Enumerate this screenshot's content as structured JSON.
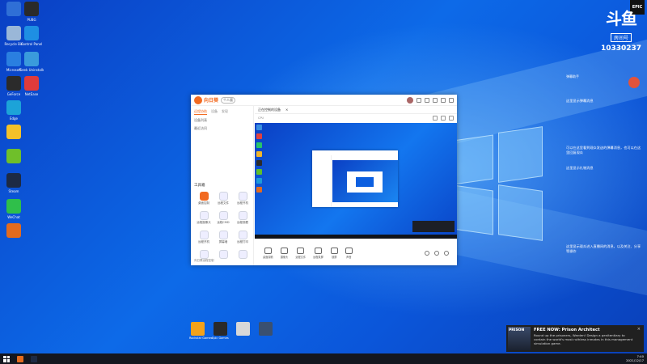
{
  "desktop": {
    "icons": [
      {
        "label": "",
        "color": "#2f6fd6"
      },
      {
        "label": "PUBG",
        "color": "#2a2a2a"
      },
      {
        "label": "Recycle Bin",
        "color": "#9ab7d8"
      },
      {
        "label": "Control Panel",
        "color": "#1e8fe3"
      },
      {
        "label": "Microsoft",
        "color": "#2a7fe0"
      },
      {
        "label": "Geek Uninstaller",
        "color": "#3a9bdc"
      },
      {
        "label": "GeForce",
        "color": "#2b2b2b"
      },
      {
        "label": "NetEase",
        "color": "#e03b3b"
      },
      {
        "label": "Edge",
        "color": "#1ca3d8"
      },
      {
        "label": "",
        "color": "#f3c12a"
      },
      {
        "label": "",
        "color": "#6fbf2a"
      },
      {
        "label": "Steam",
        "color": "#1d2a44"
      },
      {
        "label": "WeChat",
        "color": "#2fbf4a"
      },
      {
        "label": "",
        "color": "#e36b1f"
      }
    ],
    "bottom_shortcuts": [
      {
        "label": "Rockstar Games",
        "color": "#f3a21a"
      },
      {
        "label": "Epic Games",
        "color": "#2a2a2a"
      },
      {
        "label": "",
        "color": "#d8d8d8"
      },
      {
        "label": "",
        "color": "#3a5070"
      }
    ]
  },
  "overlay": {
    "brand_mark": "斗鱼",
    "room_label": "房间号",
    "room_number": "10330237",
    "epic_badge": "EPIC",
    "chat_header_left": "弹幕助手",
    "chat_header_right": "",
    "chat_lines": [
      "这里显示弹幕消息",
      "可以在这里看到观众发送的弹幕消息，也可以在这里回复观众",
      "这里显示礼物消息",
      "这里显示观众进入直播间的消息，以及关注、分享等操作"
    ]
  },
  "app": {
    "name": "向日葵",
    "edition_pill": "个人版",
    "sidebar": {
      "tabs": [
        "远程协助",
        "设备",
        "发现"
      ],
      "rows": [
        "设备列表",
        "最近访问"
      ],
      "tools_title": "工具箱",
      "tools": [
        {
          "label": "桌面控制",
          "accent": true
        },
        {
          "label": "远程文件",
          "accent": false
        },
        {
          "label": "远程开机",
          "accent": false
        },
        {
          "label": "远程摄像头",
          "accent": false
        },
        {
          "label": "远程CMD",
          "accent": false
        },
        {
          "label": "远程观看",
          "accent": false
        },
        {
          "label": "远程开机",
          "accent": false
        },
        {
          "label": "屏幕墙",
          "accent": false
        },
        {
          "label": "远程打印",
          "accent": false
        },
        {
          "label": "",
          "accent": false
        },
        {
          "label": "",
          "accent": false
        },
        {
          "label": "",
          "accent": false
        }
      ],
      "footer": "向日葵远程控制"
    },
    "tab_title": "正在控制的设备",
    "tab_close": "×",
    "add_tab": "+",
    "info_left": "CPU",
    "info_mid": "",
    "controls": [
      {
        "label": "桌面观看"
      },
      {
        "label": "摄像头"
      },
      {
        "label": "远程文件"
      },
      {
        "label": "远程录屏"
      },
      {
        "label": "锁屏"
      },
      {
        "label": "声音"
      }
    ]
  },
  "notification": {
    "game_art": "PRISON",
    "title": "FREE NOW: Prison Architect",
    "body": "Round up the prisoners, Warden! Design a penitentiary to contain the world's most ruthless inmates in this management simulation game.",
    "close": "×"
  },
  "taskbar": {
    "time": "7:40",
    "date": "2021/12/17",
    "apps": [
      {
        "color": "#e36b1f"
      },
      {
        "color": "#1d2a44"
      }
    ]
  }
}
